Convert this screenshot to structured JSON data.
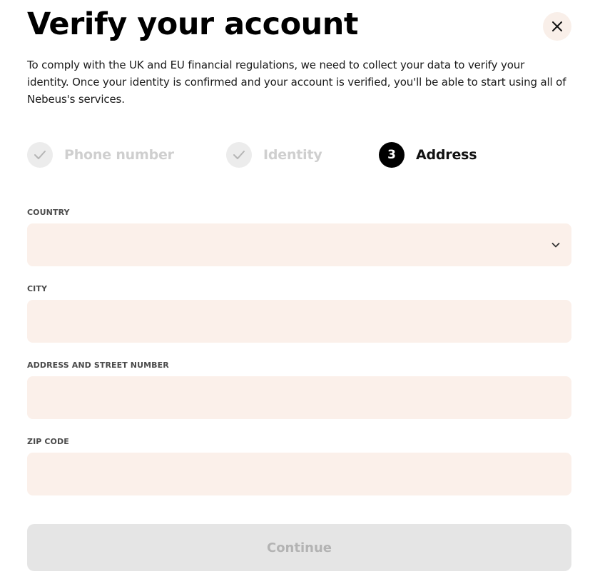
{
  "header": {
    "title": "Verify your account",
    "close_icon": "close-icon"
  },
  "intro": {
    "text": "To comply with the UK and EU financial regulations, we need to collect your data to verify your identity. Once your identity is confirmed and your account is verified, you'll be able to start using all of Nebeus's services."
  },
  "steps": [
    {
      "label": "Phone number",
      "status": "completed",
      "icon": "check-icon"
    },
    {
      "label": "Identity",
      "status": "completed",
      "icon": "check-icon"
    },
    {
      "label": "Address",
      "status": "active",
      "number": "3"
    }
  ],
  "form": {
    "country": {
      "label": "COUNTRY",
      "value": "",
      "icon": "chevron-down-icon"
    },
    "city": {
      "label": "CITY",
      "value": ""
    },
    "address": {
      "label": "ADDRESS AND STREET NUMBER",
      "value": ""
    },
    "zip": {
      "label": "ZIP CODE",
      "value": ""
    }
  },
  "actions": {
    "continue_label": "Continue",
    "continue_enabled": false
  },
  "colors": {
    "field_background": "#fbf0ea",
    "close_button_background": "#f9efe9",
    "completed_step": "#cfcfcf",
    "active_step": "#000000",
    "disabled_button": "#e5e5e5",
    "disabled_button_text": "#b3b3b3"
  }
}
